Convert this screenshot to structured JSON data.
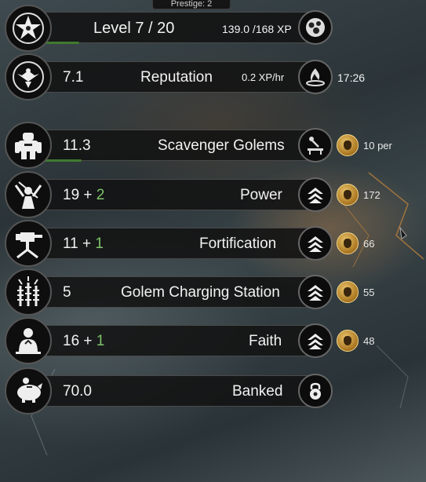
{
  "prestige": "Prestige: 2",
  "level": {
    "label": "Level 7 / 20",
    "xp": "139.0 /168 XP",
    "progress": 0.14
  },
  "reputation": {
    "value": "7.1",
    "label": "Reputation",
    "rate": "0.2 XP/hr",
    "timer": "17:26"
  },
  "rows": [
    {
      "value": "11.3",
      "bonus": "",
      "label": "Scavenger Golems",
      "cost": "10 per",
      "progress": 0.15
    },
    {
      "value": "19 + ",
      "bonus": "2",
      "label": "Power",
      "cost": "172"
    },
    {
      "value": "11 + ",
      "bonus": "1",
      "label": "Fortification",
      "cost": "66"
    },
    {
      "value": "5",
      "bonus": "",
      "label": "Golem Charging Station",
      "cost": "55"
    },
    {
      "value": "16 + ",
      "bonus": "1",
      "label": "Faith",
      "cost": "48"
    },
    {
      "value": "70.0",
      "bonus": "",
      "label": "Banked"
    }
  ],
  "colors": {
    "progress": "#3f7a2e",
    "bonus": "#7fc46b",
    "coin": "#c8922e"
  }
}
